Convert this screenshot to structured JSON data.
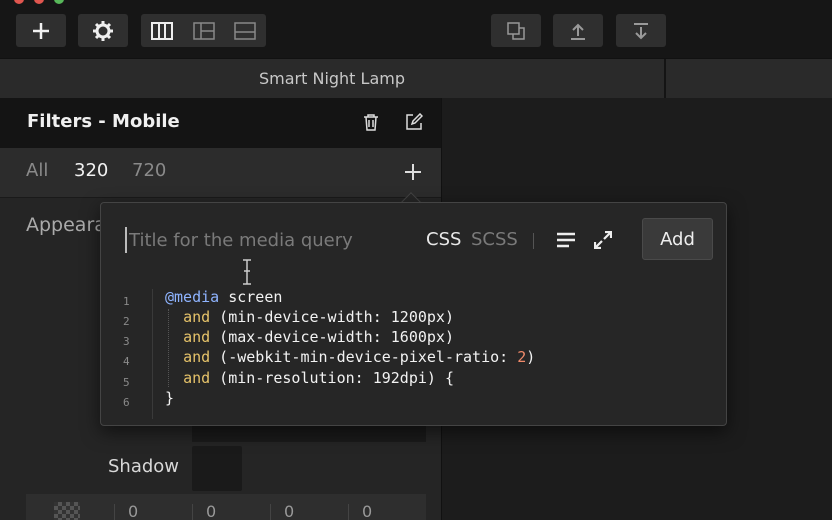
{
  "document": {
    "title": "Smart Night Lamp"
  },
  "toolbar": {
    "add_icon": "plus-icon",
    "settings_icon": "gear-icon",
    "layout_icons": [
      "columns-layout-icon",
      "sidebar-layout-icon",
      "split-layout-icon"
    ],
    "right_icons": [
      "duplicate-icon",
      "upload-icon",
      "download-icon"
    ]
  },
  "panel": {
    "title": "Filters - Mobile",
    "tabs": [
      {
        "label": "All",
        "active": false
      },
      {
        "label": "320",
        "active": true
      },
      {
        "label": "720",
        "active": false
      }
    ],
    "section_label": "Appeara",
    "shadow_label": "Shadow",
    "bottom_values": [
      "0",
      "0",
      "0",
      "0"
    ]
  },
  "popover": {
    "placeholder": "Title for the media query",
    "lang_css": "CSS",
    "lang_scss": "SCSS",
    "add_label": "Add",
    "line_numbers": [
      "1",
      "2",
      "3",
      "4",
      "5",
      "6"
    ],
    "code": {
      "l1_at": "@media",
      "l1_rest": " screen",
      "l2_and": "and",
      "l2_rest": " (min-device-width: 1200px)",
      "l3_and": "and",
      "l3_rest": " (max-device-width: 1600px)",
      "l4_and": "and",
      "l4_rest": " (-webkit-min-device-pixel-ratio: ",
      "l4_num": "2",
      "l4_end": ")",
      "l5_and": "and",
      "l5_rest": " (min-resolution: 192dpi) {",
      "l6": "}"
    }
  },
  "colors": {
    "accent_blue": "#8fb4ff",
    "keyword_yellow": "#e6c36a",
    "number_red": "#f08a6a"
  }
}
